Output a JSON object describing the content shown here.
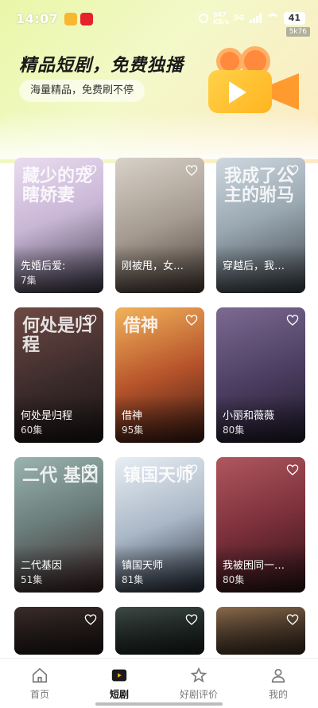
{
  "status_bar": {
    "time": "14:07",
    "net_speed_value": "947",
    "net_speed_unit": "KB/s",
    "network": "5G",
    "battery": "41",
    "speed_tag": "5k76"
  },
  "hero": {
    "title": "精品短剧，免费独播",
    "subtitle": "海量精品，免费刷不停"
  },
  "dramas": [
    {
      "title": "先婚后爱:",
      "episodes": "7集",
      "art": "藏少的宠瞎娇妻",
      "bg": "linear-gradient(160deg,#e9dcef 0%,#c9b6d6 45%,#3d3a4a 100%)"
    },
    {
      "title": "刚被甩，女…",
      "episodes": "",
      "art": "",
      "bg": "linear-gradient(160deg,#d9d2c9 0%,#a59b90 50%,#4a3e38 100%)"
    },
    {
      "title": "穿越后，我…",
      "episodes": "",
      "art": "我成了公主的驸马",
      "bg": "linear-gradient(160deg,#cfd8df 0%,#9aa8b2 45%,#3c4248 100%)"
    },
    {
      "title": "何处是归程",
      "episodes": "60集",
      "art": "何处是归程",
      "bg": "linear-gradient(160deg,#6e4a44 0%,#3a2a2a 55%,#1b1414 100%)"
    },
    {
      "title": "借神",
      "episodes": "95集",
      "art": "借神",
      "bg": "linear-gradient(160deg,#f2b35a 0%,#b7542b 50%,#3a1a14 100%)"
    },
    {
      "title": "小丽和薇薇",
      "episodes": "80集",
      "art": "",
      "bg": "linear-gradient(160deg,#7d6a92 0%,#4d3f63 50%,#1f1a2a 100%)"
    },
    {
      "title": "二代基因",
      "episodes": "51集",
      "art": "二代 基因",
      "bg": "linear-gradient(160deg,#9bb3b0 0%,#6a7e7b 45%,#3b2224 100%)"
    },
    {
      "title": "镇国天师",
      "episodes": "81集",
      "art": "镇国天师",
      "bg": "linear-gradient(160deg,#e8eef4 0%,#aab7c6 50%,#26303d 100%)"
    },
    {
      "title": "我被困同一…",
      "episodes": "80集",
      "art": "",
      "bg": "linear-gradient(160deg,#b0575f 0%,#7a2f3a 50%,#2a1316 100%)"
    },
    {
      "title": "",
      "episodes": "",
      "art": "",
      "bg": "linear-gradient(160deg,#3b2d2b 0%,#1e1716 100%)"
    },
    {
      "title": "",
      "episodes": "",
      "art": "",
      "bg": "linear-gradient(160deg,#3e4a45 0%,#18201e 100%)"
    },
    {
      "title": "",
      "episodes": "",
      "art": "",
      "bg": "linear-gradient(160deg,#8a6b4c 0%,#3b2c22 100%)"
    }
  ],
  "tabs": [
    {
      "label": "首页"
    },
    {
      "label": "短剧"
    },
    {
      "label": "好剧评价"
    },
    {
      "label": "我的"
    }
  ],
  "colors": {
    "accent": "#ffb41f",
    "header_start": "#e9f7a8",
    "header_end": "#fde9c3"
  }
}
